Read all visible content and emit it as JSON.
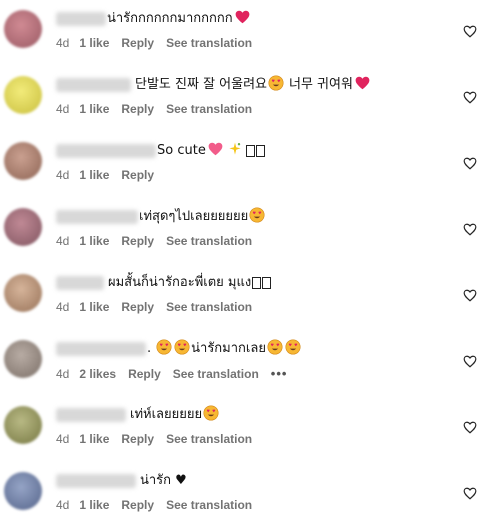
{
  "accent_colors": {
    "meta_text": "#737373",
    "heart_red": "#e0245e",
    "blur_grey": "#d8d8d8"
  },
  "comments": [
    {
      "id": "c1",
      "text": "น่ารักกกกกกมากกกกก",
      "emojis_after": [
        "red-heart-emoji"
      ],
      "age": "4d",
      "likes": "1 like",
      "reply": "Reply",
      "translate": "See translation",
      "avatar_color": "#b5707a",
      "has_more": false
    },
    {
      "id": "c2",
      "text": "단발도 진짜 잘 어울려요",
      "text_after": "너무 귀여워",
      "age": "4d",
      "likes": "1 like",
      "reply": "Reply",
      "translate": "See translation",
      "avatar_color": "#e1d85a",
      "has_more": false
    },
    {
      "id": "c3",
      "text": "So cute",
      "age": "4d",
      "likes": "1 like",
      "reply": "Reply",
      "avatar_color": "#b4897a",
      "has_more": false
    },
    {
      "id": "c4",
      "text": "เท่สุดๆไปเลยยยยยย",
      "age": "4d",
      "likes": "1 like",
      "reply": "Reply",
      "translate": "See translation",
      "avatar_color": "#a5707e",
      "has_more": false
    },
    {
      "id": "c5",
      "text": "ผมสั้นก็น่ารักอะพี่เตย มุแง",
      "age": "4d",
      "likes": "1 like",
      "reply": "Reply",
      "translate": "See translation",
      "avatar_color": "#b6967c",
      "has_more": false
    },
    {
      "id": "c6",
      "text_before": ".",
      "text": "น่ารักมากเลย",
      "age": "4d",
      "likes": "2 likes",
      "reply": "Reply",
      "translate": "See translation",
      "more": "•••",
      "avatar_color": "#9d8f86",
      "has_more": true
    },
    {
      "id": "c7",
      "text": "เท่ห์เลยยยยย",
      "age": "4d",
      "likes": "1 like",
      "reply": "Reply",
      "translate": "See translation",
      "avatar_color": "#9a9b6a",
      "has_more": false
    },
    {
      "id": "c8",
      "text": "น่ารัก ♥",
      "age": "4d",
      "likes": "1 like",
      "reply": "Reply",
      "translate": "See translation",
      "avatar_color": "#6e7ea6",
      "has_more": false
    }
  ]
}
